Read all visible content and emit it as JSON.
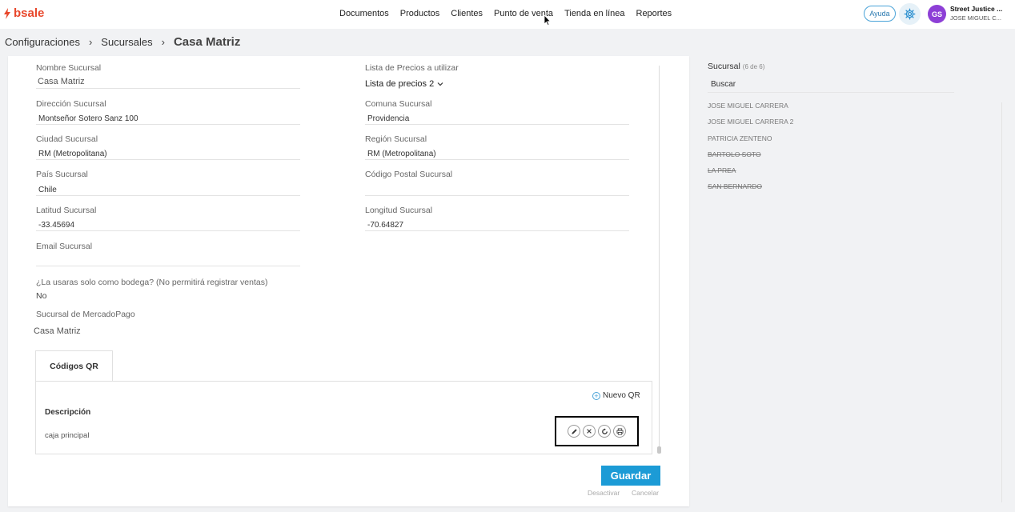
{
  "brand": {
    "name": "bsale",
    "color": "#e8472b"
  },
  "nav": [
    "Documentos",
    "Productos",
    "Clientes",
    "Punto de venta",
    "Tienda en línea",
    "Reportes"
  ],
  "header": {
    "help_label": "Ayuda",
    "avatar_initials": "GS",
    "company": "Street Justice ...",
    "user": "JOSE MIGUEL C..."
  },
  "breadcrumb": [
    "Configuraciones",
    "Sucursales",
    "Casa Matriz"
  ],
  "form": {
    "nombre_label": "Nombre Sucursal",
    "nombre_value": "Casa Matriz",
    "lista_label": "Lista de Precios a utilizar",
    "lista_value": "Lista de precios 2",
    "direccion_label": "Dirección Sucursal",
    "direccion_value": "Montseñor Sotero Sanz 100",
    "comuna_label": "Comuna Sucursal",
    "comuna_value": "Providencia",
    "ciudad_label": "Ciudad Sucursal",
    "ciudad_value": "RM (Metropolitana)",
    "region_label": "Región Sucursal",
    "region_value": "RM (Metropolitana)",
    "pais_label": "País Sucursal",
    "pais_value": "Chile",
    "postal_label": "Código Postal Sucursal",
    "postal_value": "",
    "latitud_label": "Latitud Sucursal",
    "latitud_value": "-33.45694",
    "longitud_label": "Longitud Sucursal",
    "longitud_value": "-70.64827",
    "email_label": "Email Sucursal",
    "email_value": "",
    "bodega_label": "¿La usaras solo como bodega? (No permitirá registrar ventas)",
    "bodega_value": "No",
    "mercadopago_label": "Sucursal de MercadoPago",
    "mercadopago_value": "Casa Matriz"
  },
  "qr": {
    "tab_label": "Códigos QR",
    "new_label": "Nuevo QR",
    "column_header": "Descripción",
    "rows": [
      "caja principal"
    ],
    "action_icons": [
      "edit-icon",
      "delete-icon",
      "refresh-icon",
      "print-icon"
    ]
  },
  "buttons": {
    "save": "Guardar",
    "deactivate": "Desactivar",
    "cancel": "Cancelar",
    "save_color": "#1c9bd6"
  },
  "sidebar": {
    "title": "Sucursal",
    "count": "(6 de 6)",
    "search_placeholder": "Buscar",
    "items": [
      {
        "label": "JOSE MIGUEL CARRERA",
        "inactive": false
      },
      {
        "label": "JOSE MIGUEL CARRERA 2",
        "inactive": false
      },
      {
        "label": "PATRICIA ZENTENO",
        "inactive": false
      },
      {
        "label": "BARTOLO SOTO",
        "inactive": true
      },
      {
        "label": "LA PREA",
        "inactive": true
      },
      {
        "label": "SAN BERNARDO",
        "inactive": true
      }
    ]
  }
}
